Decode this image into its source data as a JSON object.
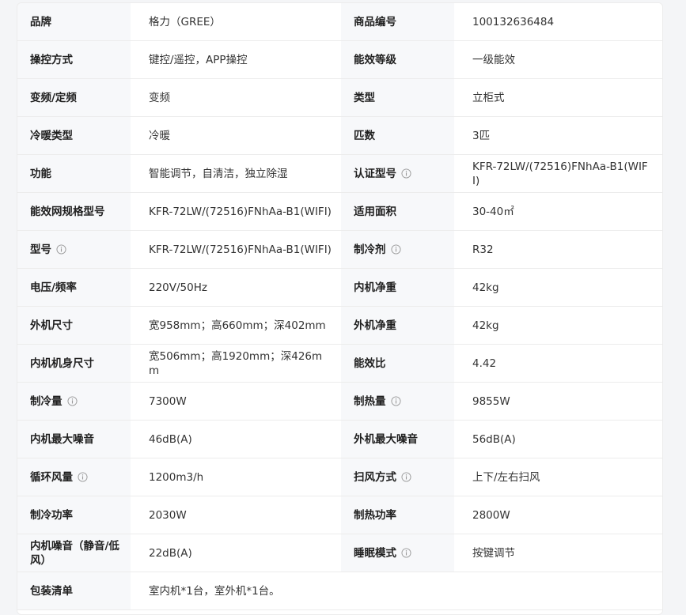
{
  "specs": [
    {
      "left": {
        "label": "品牌",
        "value": "格力（GREE）"
      },
      "right": {
        "label": "商品编号",
        "value": "100132636484"
      }
    },
    {
      "left": {
        "label": "操控方式",
        "value": "键控/遥控，APP操控"
      },
      "right": {
        "label": "能效等级",
        "value": "一级能效"
      }
    },
    {
      "left": {
        "label": "变频/定频",
        "value": "变频"
      },
      "right": {
        "label": "类型",
        "value": "立柜式"
      }
    },
    {
      "left": {
        "label": "冷暖类型",
        "value": "冷暖"
      },
      "right": {
        "label": "匹数",
        "value": "3匹"
      }
    },
    {
      "left": {
        "label": "功能",
        "value": "智能调节，自清洁，独立除湿"
      },
      "right": {
        "label": "认证型号",
        "value": "KFR-72LW/(72516)FNhAa-B1(WIFI)",
        "info": true
      }
    },
    {
      "left": {
        "label": "能效网规格型号",
        "value": "KFR-72LW/(72516)FNhAa-B1(WIFI)"
      },
      "right": {
        "label": "适用面积",
        "value": "30-40㎡"
      }
    },
    {
      "left": {
        "label": "型号",
        "value": "KFR-72LW/(72516)FNhAa-B1(WIFI)",
        "info": true
      },
      "right": {
        "label": "制冷剂",
        "value": "R32",
        "info": true
      }
    },
    {
      "left": {
        "label": "电压/频率",
        "value": "220V/50Hz"
      },
      "right": {
        "label": "内机净重",
        "value": "42kg"
      }
    },
    {
      "left": {
        "label": "外机尺寸",
        "value": "宽958mm；高660mm；深402mm"
      },
      "right": {
        "label": "外机净重",
        "value": "42kg"
      }
    },
    {
      "left": {
        "label": "内机机身尺寸",
        "value": "宽506mm；高1920mm；深426mm"
      },
      "right": {
        "label": "能效比",
        "value": "4.42"
      }
    },
    {
      "left": {
        "label": "制冷量",
        "value": "7300W",
        "info": true
      },
      "right": {
        "label": "制热量",
        "value": "9855W",
        "info": true
      }
    },
    {
      "left": {
        "label": "内机最大噪音",
        "value": "46dB(A)"
      },
      "right": {
        "label": "外机最大噪音",
        "value": "56dB(A)"
      }
    },
    {
      "left": {
        "label": "循环风量",
        "value": "1200m3/h",
        "info": true
      },
      "right": {
        "label": "扫风方式",
        "value": "上下/左右扫风",
        "info": true
      }
    },
    {
      "left": {
        "label": "制冷功率",
        "value": "2030W"
      },
      "right": {
        "label": "制热功率",
        "value": "2800W"
      }
    },
    {
      "left": {
        "label": "内机噪音（静音/低风）",
        "value": "22dB(A)"
      },
      "right": {
        "label": "睡眠模式",
        "value": "按键调节",
        "info": true
      }
    },
    {
      "left": {
        "label": "包装清单",
        "value": "室内机*1台，室外机*1台。"
      },
      "right": null
    }
  ],
  "icons": {
    "info": "info-circle-icon"
  },
  "colors": {
    "label_bg": "#f7f8fa",
    "border": "#ececec",
    "icon": "#9a9a9a",
    "page_bg": "#f4f5f7"
  }
}
